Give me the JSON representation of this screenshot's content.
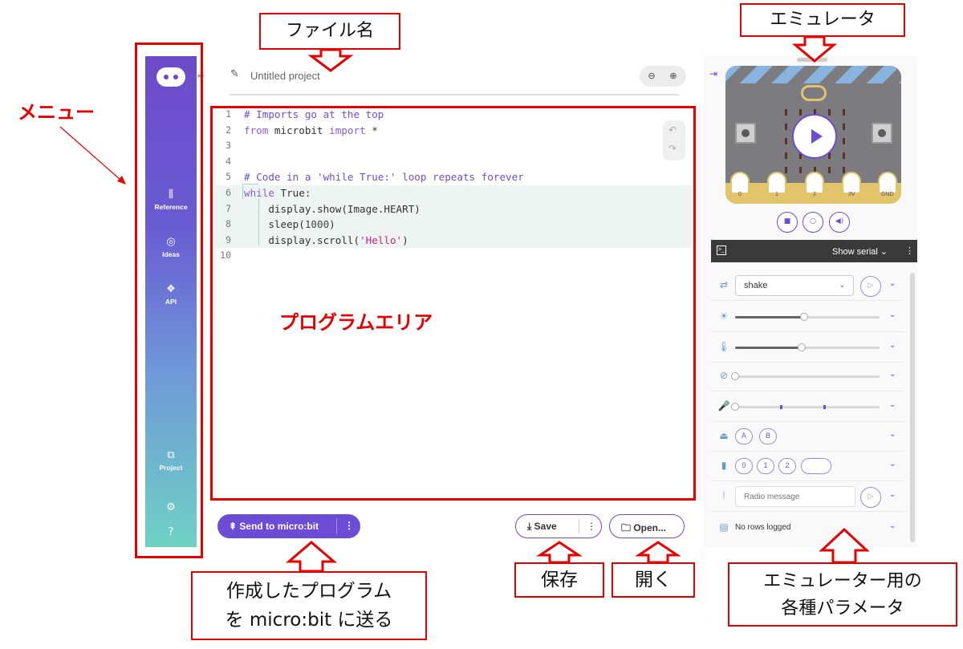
{
  "sidebar": {
    "items": [
      {
        "icon": "books-icon",
        "glyph": "⫼",
        "label": "Reference"
      },
      {
        "icon": "lightbulb-icon",
        "glyph": "◎",
        "label": "Ideas"
      },
      {
        "icon": "python-icon",
        "glyph": "❖",
        "label": "API"
      },
      {
        "icon": "project-icon",
        "glyph": "⧉",
        "label": "Project"
      }
    ],
    "settings_glyph": "⚙",
    "help_glyph": "?"
  },
  "header": {
    "project_name": "Untitled project",
    "pencil_glyph": "✎",
    "zoom_out_glyph": "⊖",
    "zoom_in_glyph": "⊕",
    "collapse_glyph": "⇤"
  },
  "editor": {
    "lines": [
      {
        "n": "1",
        "html": "<span class=\"c-comment\"># Imports go at the top</span>"
      },
      {
        "n": "2",
        "html": "<span class=\"c-kw\">from</span><span class=\"c-norm\"> microbit </span><span class=\"c-kw\">import</span><span class=\"c-norm\"> *</span>"
      },
      {
        "n": "3",
        "html": ""
      },
      {
        "n": "4",
        "html": ""
      },
      {
        "n": "5",
        "html": "<span class=\"c-comment\"># Code in a 'while True:' loop repeats forever</span>"
      },
      {
        "n": "6",
        "html": "<span class=\"c-kw\">while</span><span class=\"c-norm\"> True:</span>"
      },
      {
        "n": "7",
        "html": "<span class=\"c-norm\">    display.show(Image.HEART)</span>"
      },
      {
        "n": "8",
        "html": "<span class=\"c-norm\">    sleep(</span><span class=\"c-num\">1000</span><span class=\"c-norm\">)</span>"
      },
      {
        "n": "9",
        "html": "<span class=\"c-norm\">    display.scroll(</span><span class=\"c-str\">'Hello'</span><span class=\"c-norm\">)</span>"
      },
      {
        "n": "10",
        "html": ""
      }
    ],
    "undo_glyph": "↶",
    "redo_glyph": "↷"
  },
  "toolbar": {
    "send_label": "⇞  Send to micro:bit",
    "send_more": "⋮",
    "save_label": "⤓  Save",
    "save_more": "⋮",
    "open_label": "🗀  Open..."
  },
  "simulator": {
    "pin_labels": [
      "0",
      "1",
      "2",
      "3V",
      "GND"
    ],
    "controls": [
      "■",
      "○",
      "◀)"
    ],
    "serial": {
      "show_label": "Show serial  ⌄",
      "more": "⋮",
      "term_glyph": ">_"
    },
    "gesture": {
      "value": "shake"
    },
    "buttons": [
      "A",
      "B"
    ],
    "pins": [
      "0",
      "1",
      "2",
      ""
    ],
    "radio_placeholder": "Radio message",
    "data_logging": "No rows logged",
    "levels": {
      "light": 0.48,
      "temperature": 0.46,
      "compass": 0.0,
      "sound": 0.0
    }
  },
  "annotations": {
    "menu": "メニュー",
    "filename": "ファイル名",
    "emulator": "エミュレータ",
    "program_area": "プログラムエリア",
    "send_note_line1": "作成したプログラム",
    "send_note_line2": "を micro:bit に送る",
    "save": "保存",
    "open": "開く",
    "params_line1": "エミュレーター用の",
    "params_line2": "各種パラメータ"
  },
  "colors": {
    "accent": "#6c4bd6",
    "annotation_red": "#e60000"
  }
}
